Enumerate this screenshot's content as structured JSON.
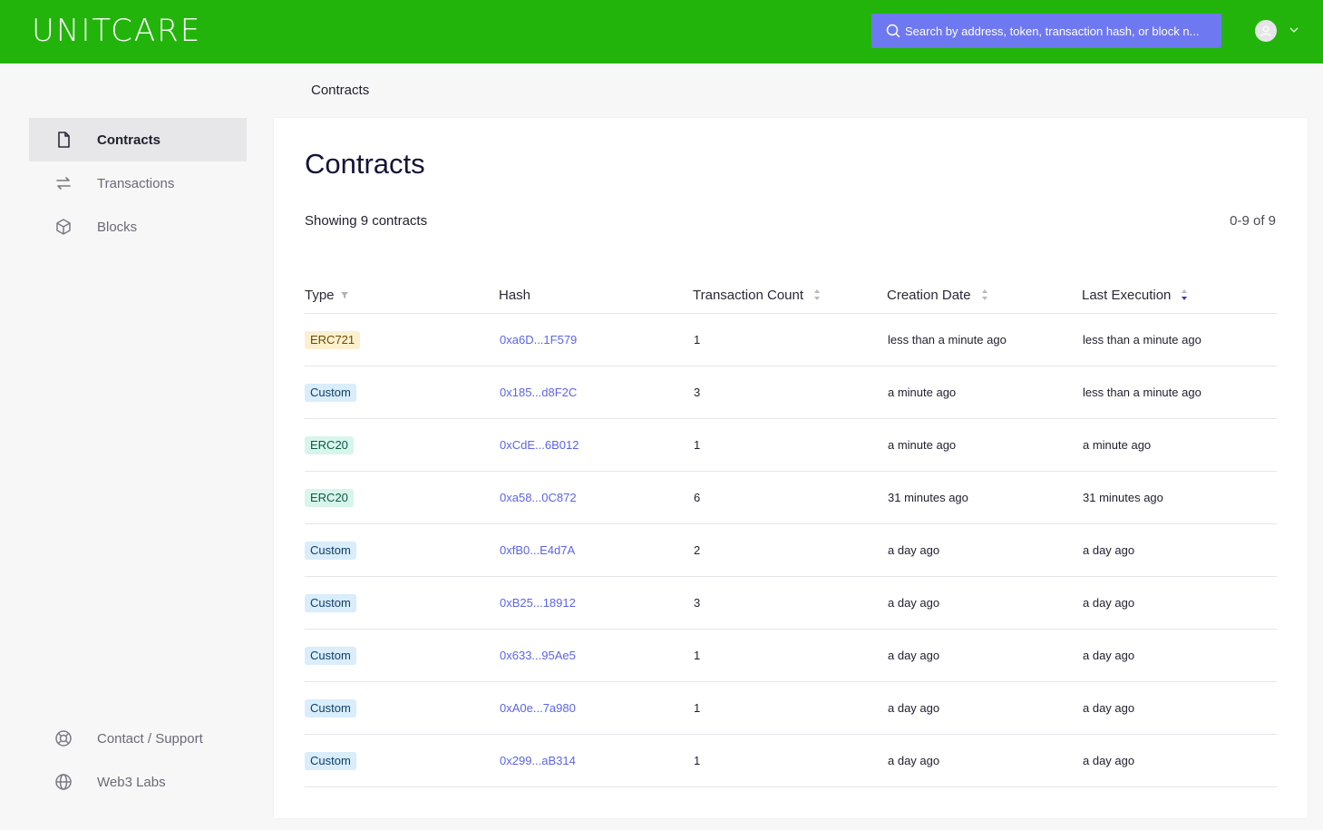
{
  "brand": {
    "logo_text": "UNITCARE"
  },
  "search": {
    "placeholder": "Search by address, token, transaction hash, or block n..."
  },
  "breadcrumb": "Contracts",
  "sidebar": {
    "items": [
      {
        "label": "Contracts",
        "icon": "file-icon",
        "active": true
      },
      {
        "label": "Transactions",
        "icon": "swap-icon",
        "active": false
      },
      {
        "label": "Blocks",
        "icon": "cube-icon",
        "active": false
      }
    ],
    "bottom_items": [
      {
        "label": "Contact / Support",
        "icon": "lifebuoy-icon"
      },
      {
        "label": "Web3 Labs",
        "icon": "globe-icon"
      }
    ]
  },
  "main": {
    "title": "Contracts",
    "showing": "Showing 9 contracts",
    "range": "0-9 of 9",
    "columns": [
      "Type",
      "Hash",
      "Transaction Count",
      "Creation Date",
      "Last Execution"
    ],
    "rows": [
      {
        "type": "ERC721",
        "hash": "0xa6D...1F579",
        "count": "1",
        "created": "less than a minute ago",
        "last": "less than a minute ago"
      },
      {
        "type": "Custom",
        "hash": "0x185...d8F2C",
        "count": "3",
        "created": "a minute ago",
        "last": "less than a minute ago"
      },
      {
        "type": "ERC20",
        "hash": "0xCdE...6B012",
        "count": "1",
        "created": "a minute ago",
        "last": "a minute ago"
      },
      {
        "type": "ERC20",
        "hash": "0xa58...0C872",
        "count": "6",
        "created": "31 minutes ago",
        "last": "31 minutes ago"
      },
      {
        "type": "Custom",
        "hash": "0xfB0...E4d7A",
        "count": "2",
        "created": "a day ago",
        "last": "a day ago"
      },
      {
        "type": "Custom",
        "hash": "0xB25...18912",
        "count": "3",
        "created": "a day ago",
        "last": "a day ago"
      },
      {
        "type": "Custom",
        "hash": "0x633...95Ae5",
        "count": "1",
        "created": "a day ago",
        "last": "a day ago"
      },
      {
        "type": "Custom",
        "hash": "0xA0e...7a980",
        "count": "1",
        "created": "a day ago",
        "last": "a day ago"
      },
      {
        "type": "Custom",
        "hash": "0x299...aB314",
        "count": "1",
        "created": "a day ago",
        "last": "a day ago"
      }
    ]
  },
  "colors": {
    "header_bg": "#22b40a",
    "search_bg": "#6e78f0",
    "link": "#5c64e8",
    "badge_erc721_bg": "#fdf0cf",
    "badge_erc721_fg": "#6b4a00",
    "badge_erc20_bg": "#d8f5ec",
    "badge_erc20_fg": "#0d5a46",
    "badge_custom_bg": "#d9edfb",
    "badge_custom_fg": "#123e63"
  }
}
